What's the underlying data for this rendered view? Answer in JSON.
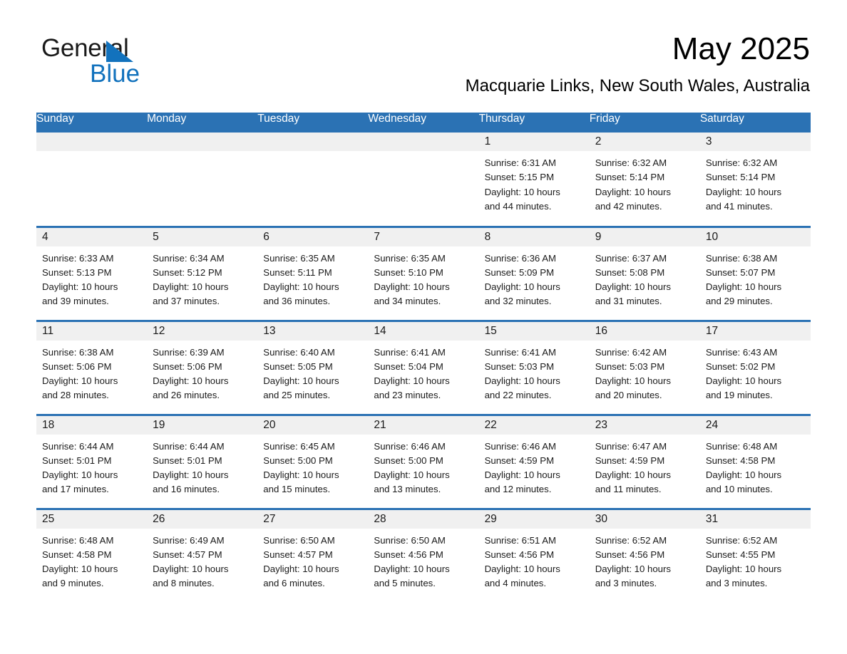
{
  "logo": {
    "word1": "General",
    "word2": "Blue",
    "triangle_color": "#1272bd"
  },
  "header": {
    "title": "May 2025",
    "subtitle": "Macquarie Links, New South Wales, Australia"
  },
  "theme": {
    "header_blue": "#2b72b4",
    "daynum_band": "#f0f0f0",
    "text": "#1a1a1a"
  },
  "calendar": {
    "weekday_headers": [
      "Sunday",
      "Monday",
      "Tuesday",
      "Wednesday",
      "Thursday",
      "Friday",
      "Saturday"
    ],
    "labels": {
      "sunrise": "Sunrise:",
      "sunset": "Sunset:",
      "daylight": "Daylight:"
    },
    "weeks": [
      [
        {
          "day": "",
          "sunrise": "",
          "sunset": "",
          "daylight_line1": "",
          "daylight_line2": "",
          "empty": true
        },
        {
          "day": "",
          "sunrise": "",
          "sunset": "",
          "daylight_line1": "",
          "daylight_line2": "",
          "empty": true
        },
        {
          "day": "",
          "sunrise": "",
          "sunset": "",
          "daylight_line1": "",
          "daylight_line2": "",
          "empty": true
        },
        {
          "day": "",
          "sunrise": "",
          "sunset": "",
          "daylight_line1": "",
          "daylight_line2": "",
          "empty": true
        },
        {
          "day": "1",
          "sunrise": "Sunrise: 6:31 AM",
          "sunset": "Sunset: 5:15 PM",
          "daylight_line1": "Daylight: 10 hours",
          "daylight_line2": "and 44 minutes.",
          "empty": false
        },
        {
          "day": "2",
          "sunrise": "Sunrise: 6:32 AM",
          "sunset": "Sunset: 5:14 PM",
          "daylight_line1": "Daylight: 10 hours",
          "daylight_line2": "and 42 minutes.",
          "empty": false
        },
        {
          "day": "3",
          "sunrise": "Sunrise: 6:32 AM",
          "sunset": "Sunset: 5:14 PM",
          "daylight_line1": "Daylight: 10 hours",
          "daylight_line2": "and 41 minutes.",
          "empty": false
        }
      ],
      [
        {
          "day": "4",
          "sunrise": "Sunrise: 6:33 AM",
          "sunset": "Sunset: 5:13 PM",
          "daylight_line1": "Daylight: 10 hours",
          "daylight_line2": "and 39 minutes.",
          "empty": false
        },
        {
          "day": "5",
          "sunrise": "Sunrise: 6:34 AM",
          "sunset": "Sunset: 5:12 PM",
          "daylight_line1": "Daylight: 10 hours",
          "daylight_line2": "and 37 minutes.",
          "empty": false
        },
        {
          "day": "6",
          "sunrise": "Sunrise: 6:35 AM",
          "sunset": "Sunset: 5:11 PM",
          "daylight_line1": "Daylight: 10 hours",
          "daylight_line2": "and 36 minutes.",
          "empty": false
        },
        {
          "day": "7",
          "sunrise": "Sunrise: 6:35 AM",
          "sunset": "Sunset: 5:10 PM",
          "daylight_line1": "Daylight: 10 hours",
          "daylight_line2": "and 34 minutes.",
          "empty": false
        },
        {
          "day": "8",
          "sunrise": "Sunrise: 6:36 AM",
          "sunset": "Sunset: 5:09 PM",
          "daylight_line1": "Daylight: 10 hours",
          "daylight_line2": "and 32 minutes.",
          "empty": false
        },
        {
          "day": "9",
          "sunrise": "Sunrise: 6:37 AM",
          "sunset": "Sunset: 5:08 PM",
          "daylight_line1": "Daylight: 10 hours",
          "daylight_line2": "and 31 minutes.",
          "empty": false
        },
        {
          "day": "10",
          "sunrise": "Sunrise: 6:38 AM",
          "sunset": "Sunset: 5:07 PM",
          "daylight_line1": "Daylight: 10 hours",
          "daylight_line2": "and 29 minutes.",
          "empty": false
        }
      ],
      [
        {
          "day": "11",
          "sunrise": "Sunrise: 6:38 AM",
          "sunset": "Sunset: 5:06 PM",
          "daylight_line1": "Daylight: 10 hours",
          "daylight_line2": "and 28 minutes.",
          "empty": false
        },
        {
          "day": "12",
          "sunrise": "Sunrise: 6:39 AM",
          "sunset": "Sunset: 5:06 PM",
          "daylight_line1": "Daylight: 10 hours",
          "daylight_line2": "and 26 minutes.",
          "empty": false
        },
        {
          "day": "13",
          "sunrise": "Sunrise: 6:40 AM",
          "sunset": "Sunset: 5:05 PM",
          "daylight_line1": "Daylight: 10 hours",
          "daylight_line2": "and 25 minutes.",
          "empty": false
        },
        {
          "day": "14",
          "sunrise": "Sunrise: 6:41 AM",
          "sunset": "Sunset: 5:04 PM",
          "daylight_line1": "Daylight: 10 hours",
          "daylight_line2": "and 23 minutes.",
          "empty": false
        },
        {
          "day": "15",
          "sunrise": "Sunrise: 6:41 AM",
          "sunset": "Sunset: 5:03 PM",
          "daylight_line1": "Daylight: 10 hours",
          "daylight_line2": "and 22 minutes.",
          "empty": false
        },
        {
          "day": "16",
          "sunrise": "Sunrise: 6:42 AM",
          "sunset": "Sunset: 5:03 PM",
          "daylight_line1": "Daylight: 10 hours",
          "daylight_line2": "and 20 minutes.",
          "empty": false
        },
        {
          "day": "17",
          "sunrise": "Sunrise: 6:43 AM",
          "sunset": "Sunset: 5:02 PM",
          "daylight_line1": "Daylight: 10 hours",
          "daylight_line2": "and 19 minutes.",
          "empty": false
        }
      ],
      [
        {
          "day": "18",
          "sunrise": "Sunrise: 6:44 AM",
          "sunset": "Sunset: 5:01 PM",
          "daylight_line1": "Daylight: 10 hours",
          "daylight_line2": "and 17 minutes.",
          "empty": false
        },
        {
          "day": "19",
          "sunrise": "Sunrise: 6:44 AM",
          "sunset": "Sunset: 5:01 PM",
          "daylight_line1": "Daylight: 10 hours",
          "daylight_line2": "and 16 minutes.",
          "empty": false
        },
        {
          "day": "20",
          "sunrise": "Sunrise: 6:45 AM",
          "sunset": "Sunset: 5:00 PM",
          "daylight_line1": "Daylight: 10 hours",
          "daylight_line2": "and 15 minutes.",
          "empty": false
        },
        {
          "day": "21",
          "sunrise": "Sunrise: 6:46 AM",
          "sunset": "Sunset: 5:00 PM",
          "daylight_line1": "Daylight: 10 hours",
          "daylight_line2": "and 13 minutes.",
          "empty": false
        },
        {
          "day": "22",
          "sunrise": "Sunrise: 6:46 AM",
          "sunset": "Sunset: 4:59 PM",
          "daylight_line1": "Daylight: 10 hours",
          "daylight_line2": "and 12 minutes.",
          "empty": false
        },
        {
          "day": "23",
          "sunrise": "Sunrise: 6:47 AM",
          "sunset": "Sunset: 4:59 PM",
          "daylight_line1": "Daylight: 10 hours",
          "daylight_line2": "and 11 minutes.",
          "empty": false
        },
        {
          "day": "24",
          "sunrise": "Sunrise: 6:48 AM",
          "sunset": "Sunset: 4:58 PM",
          "daylight_line1": "Daylight: 10 hours",
          "daylight_line2": "and 10 minutes.",
          "empty": false
        }
      ],
      [
        {
          "day": "25",
          "sunrise": "Sunrise: 6:48 AM",
          "sunset": "Sunset: 4:58 PM",
          "daylight_line1": "Daylight: 10 hours",
          "daylight_line2": "and 9 minutes.",
          "empty": false
        },
        {
          "day": "26",
          "sunrise": "Sunrise: 6:49 AM",
          "sunset": "Sunset: 4:57 PM",
          "daylight_line1": "Daylight: 10 hours",
          "daylight_line2": "and 8 minutes.",
          "empty": false
        },
        {
          "day": "27",
          "sunrise": "Sunrise: 6:50 AM",
          "sunset": "Sunset: 4:57 PM",
          "daylight_line1": "Daylight: 10 hours",
          "daylight_line2": "and 6 minutes.",
          "empty": false
        },
        {
          "day": "28",
          "sunrise": "Sunrise: 6:50 AM",
          "sunset": "Sunset: 4:56 PM",
          "daylight_line1": "Daylight: 10 hours",
          "daylight_line2": "and 5 minutes.",
          "empty": false
        },
        {
          "day": "29",
          "sunrise": "Sunrise: 6:51 AM",
          "sunset": "Sunset: 4:56 PM",
          "daylight_line1": "Daylight: 10 hours",
          "daylight_line2": "and 4 minutes.",
          "empty": false
        },
        {
          "day": "30",
          "sunrise": "Sunrise: 6:52 AM",
          "sunset": "Sunset: 4:56 PM",
          "daylight_line1": "Daylight: 10 hours",
          "daylight_line2": "and 3 minutes.",
          "empty": false
        },
        {
          "day": "31",
          "sunrise": "Sunrise: 6:52 AM",
          "sunset": "Sunset: 4:55 PM",
          "daylight_line1": "Daylight: 10 hours",
          "daylight_line2": "and 3 minutes.",
          "empty": false
        }
      ]
    ]
  }
}
